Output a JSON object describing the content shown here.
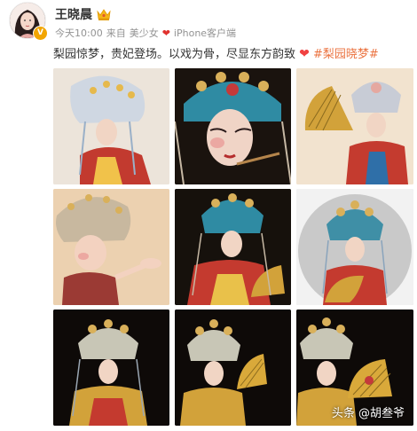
{
  "author": {
    "name": "王晓晨",
    "crown_icon": "crown-icon",
    "verified_badge": "V",
    "avatar_icon": "avatar"
  },
  "post_meta": {
    "time": "今天10:00",
    "from_label": "来自",
    "source": "美少女",
    "device": "iPhone客户端"
  },
  "post_text": {
    "body": "梨园惊梦，贵妃登场。以戏为骨，尽显东方韵致",
    "heart": "❤",
    "hashtag": "#梨园晓梦#"
  },
  "photos": [
    {
      "label": "photo-1"
    },
    {
      "label": "photo-2"
    },
    {
      "label": "photo-3"
    },
    {
      "label": "photo-4"
    },
    {
      "label": "photo-5"
    },
    {
      "label": "photo-6"
    },
    {
      "label": "photo-7"
    },
    {
      "label": "photo-8"
    },
    {
      "label": "photo-9"
    }
  ],
  "watermark": "头条 @胡叁爷",
  "colors": {
    "hashtag": "#eb7340",
    "heart": "#f04141",
    "verify_badge": "#f2a500",
    "meta_text": "#939393"
  }
}
